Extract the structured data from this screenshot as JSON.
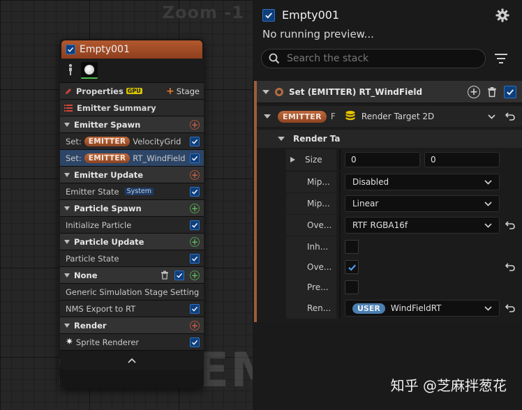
{
  "graph": {
    "zoom_label": "Zoom -1",
    "watermark": "SYSTEM",
    "node": {
      "title": "Empty001",
      "properties_label": "Properties",
      "gpu_badge": "GPU",
      "stage_label": "Stage",
      "stage_plus": "+",
      "summary_label": "Emitter Summary",
      "sections": [
        {
          "label": "Emitter Spawn",
          "items": [
            {
              "prefix": "Set:",
              "tag": "EMITTER",
              "text": "VelocityGrid"
            },
            {
              "prefix": "Set:",
              "tag": "EMITTER",
              "text": "RT_WindField"
            }
          ]
        },
        {
          "label": "Emitter Update",
          "items": [
            {
              "text": "Emitter State",
              "badge": "System"
            }
          ]
        },
        {
          "label": "Particle Spawn",
          "items": [
            {
              "text": "Initialize Particle"
            }
          ]
        },
        {
          "label": "Particle Update",
          "items": [
            {
              "text": "Particle State"
            }
          ]
        },
        {
          "label": "None",
          "items": [
            {
              "text": "Generic Simulation Stage Settings"
            },
            {
              "text": "NMS Export to RT"
            }
          ]
        },
        {
          "label": "Render",
          "items": [
            {
              "text": "Sprite Renderer"
            }
          ]
        }
      ]
    }
  },
  "panel": {
    "title": "Empty001",
    "preview_text": "No running preview...",
    "search_placeholder": "Search the stack",
    "module_title": "Set (EMITTER) RT_WindField",
    "emitter_tag": "EMITTER",
    "emitter_var_abbrev": "F",
    "emitter_type": "Render Target 2D",
    "rt_header": "Render Ta",
    "props": {
      "size": {
        "label": "Size",
        "x": "0",
        "y": "0"
      },
      "mip1": {
        "label": "Mip...",
        "value": "Disabled"
      },
      "mip2": {
        "label": "Mip...",
        "value": "Linear"
      },
      "override_format": {
        "label": "Ove...",
        "value": "RTF RGBA16f"
      },
      "inherit": {
        "label": "Inh..."
      },
      "override2": {
        "label": "Ove..."
      },
      "preview": {
        "label": "Pre..."
      },
      "render": {
        "label": "Ren...",
        "tag": "USER",
        "value": "WindFieldRT"
      }
    }
  },
  "watermark_zh": "知乎 @芝麻拌葱花",
  "colors": {
    "emitter_orange": "#b2582e",
    "checkbox_blue": "#0e3f7a",
    "user_blue": "#4b7fb0"
  }
}
